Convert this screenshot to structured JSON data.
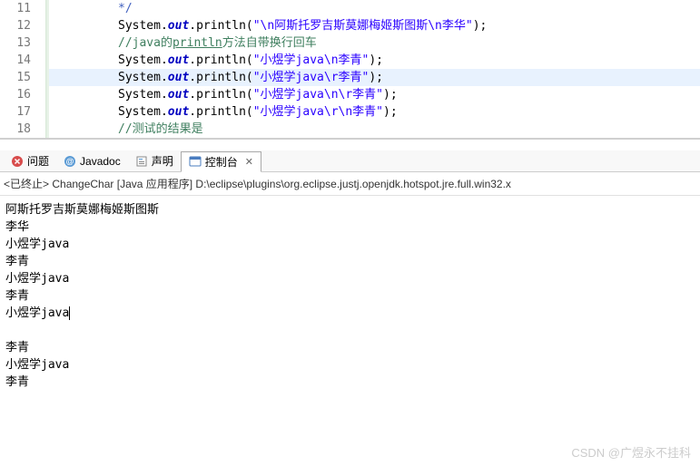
{
  "editor": {
    "lines": [
      {
        "num": "11",
        "type": "comment-end",
        "text": "*/"
      },
      {
        "num": "12",
        "type": "println",
        "str": "\"\\n阿斯托罗吉斯莫娜梅姬斯图斯\\n李华\""
      },
      {
        "num": "13",
        "type": "comment",
        "text": "//java的println方法自带换行回车"
      },
      {
        "num": "14",
        "type": "println",
        "str": "\"小煜学java\\n李青\""
      },
      {
        "num": "15",
        "type": "println",
        "str": "\"小煜学java\\r李青\"",
        "highlighted": true
      },
      {
        "num": "16",
        "type": "println",
        "str": "\"小煜学java\\n\\r李青\""
      },
      {
        "num": "17",
        "type": "println",
        "str": "\"小煜学java\\r\\n李青\""
      },
      {
        "num": "18",
        "type": "comment",
        "text": "//测试的结果是"
      }
    ],
    "system": "System",
    "out": "out",
    "println": "println"
  },
  "tabs": {
    "problems": "问题",
    "javadoc": "Javadoc",
    "declaration": "声明",
    "console": "控制台"
  },
  "terminated": "<已终止> ChangeChar [Java 应用程序] D:\\eclipse\\plugins\\org.eclipse.justj.openjdk.hotspot.jre.full.win32.x",
  "console_output": [
    "阿斯托罗吉斯莫娜梅姬斯图斯",
    "李华",
    "小煜学java",
    "李青",
    "小煜学java",
    "李青",
    "小煜学java",
    "",
    "李青",
    "小煜学java",
    "李青"
  ],
  "watermark": "CSDN @广煜永不挂科"
}
